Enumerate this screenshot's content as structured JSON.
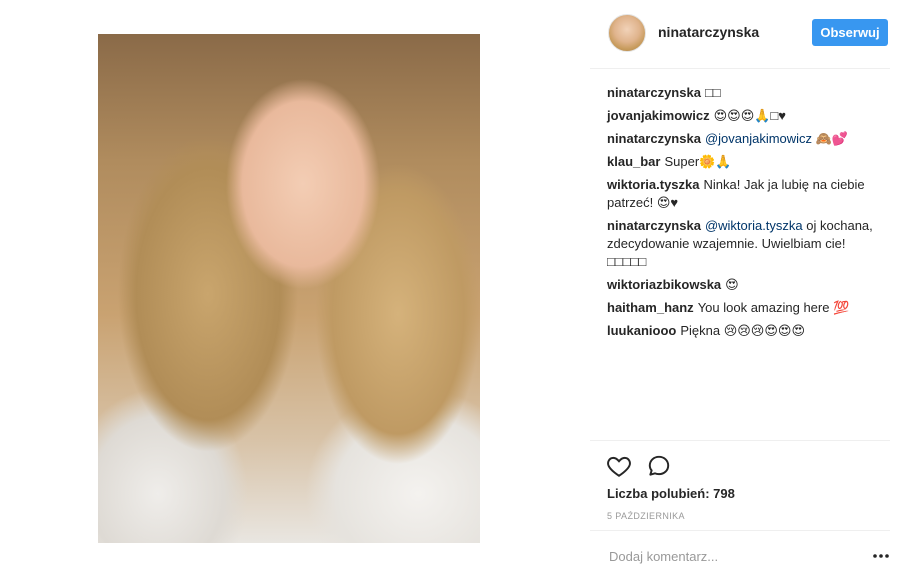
{
  "post": {
    "image_alt": "Selfie photo",
    "author": "ninatarczynska",
    "follow_label": "Obserwuj"
  },
  "comments": [
    {
      "user": "ninatarczynska",
      "mention": "",
      "text": "□□"
    },
    {
      "user": "jovanjakimowicz",
      "mention": "",
      "text": "😍😍😍🙏□♥"
    },
    {
      "user": "ninatarczynska",
      "mention": "@jovanjakimowicz",
      "text": "🙈💕"
    },
    {
      "user": "klau_bar",
      "mention": "",
      "text": "Super🌼🙏"
    },
    {
      "user": "wiktoria.tyszka",
      "mention": "",
      "text": "Ninka! Jak ja lubię na ciebie patrzeć! 😍♥"
    },
    {
      "user": "ninatarczynska",
      "mention": "@wiktoria.tyszka",
      "text": "oj kochana, zdecydowanie wzajemnie. Uwielbiam cie! □□□□□"
    },
    {
      "user": "wiktoriazbikowska",
      "mention": "",
      "text": "😍"
    },
    {
      "user": "haitham_hanz",
      "mention": "",
      "text": "You look amazing here 💯"
    },
    {
      "user": "luukaniooo",
      "mention": "",
      "text": "Piękna 😢😢😢😍😍😍"
    }
  ],
  "actions": {
    "like_icon": "heart-icon",
    "comment_icon": "comment-bubble-icon"
  },
  "likes_text": "Liczba polubień: 798",
  "date_text": "5 PAŹDZIERNIKA",
  "add_comment": {
    "placeholder": "Dodaj komentarz...",
    "more_icon": "more-dots-icon"
  }
}
